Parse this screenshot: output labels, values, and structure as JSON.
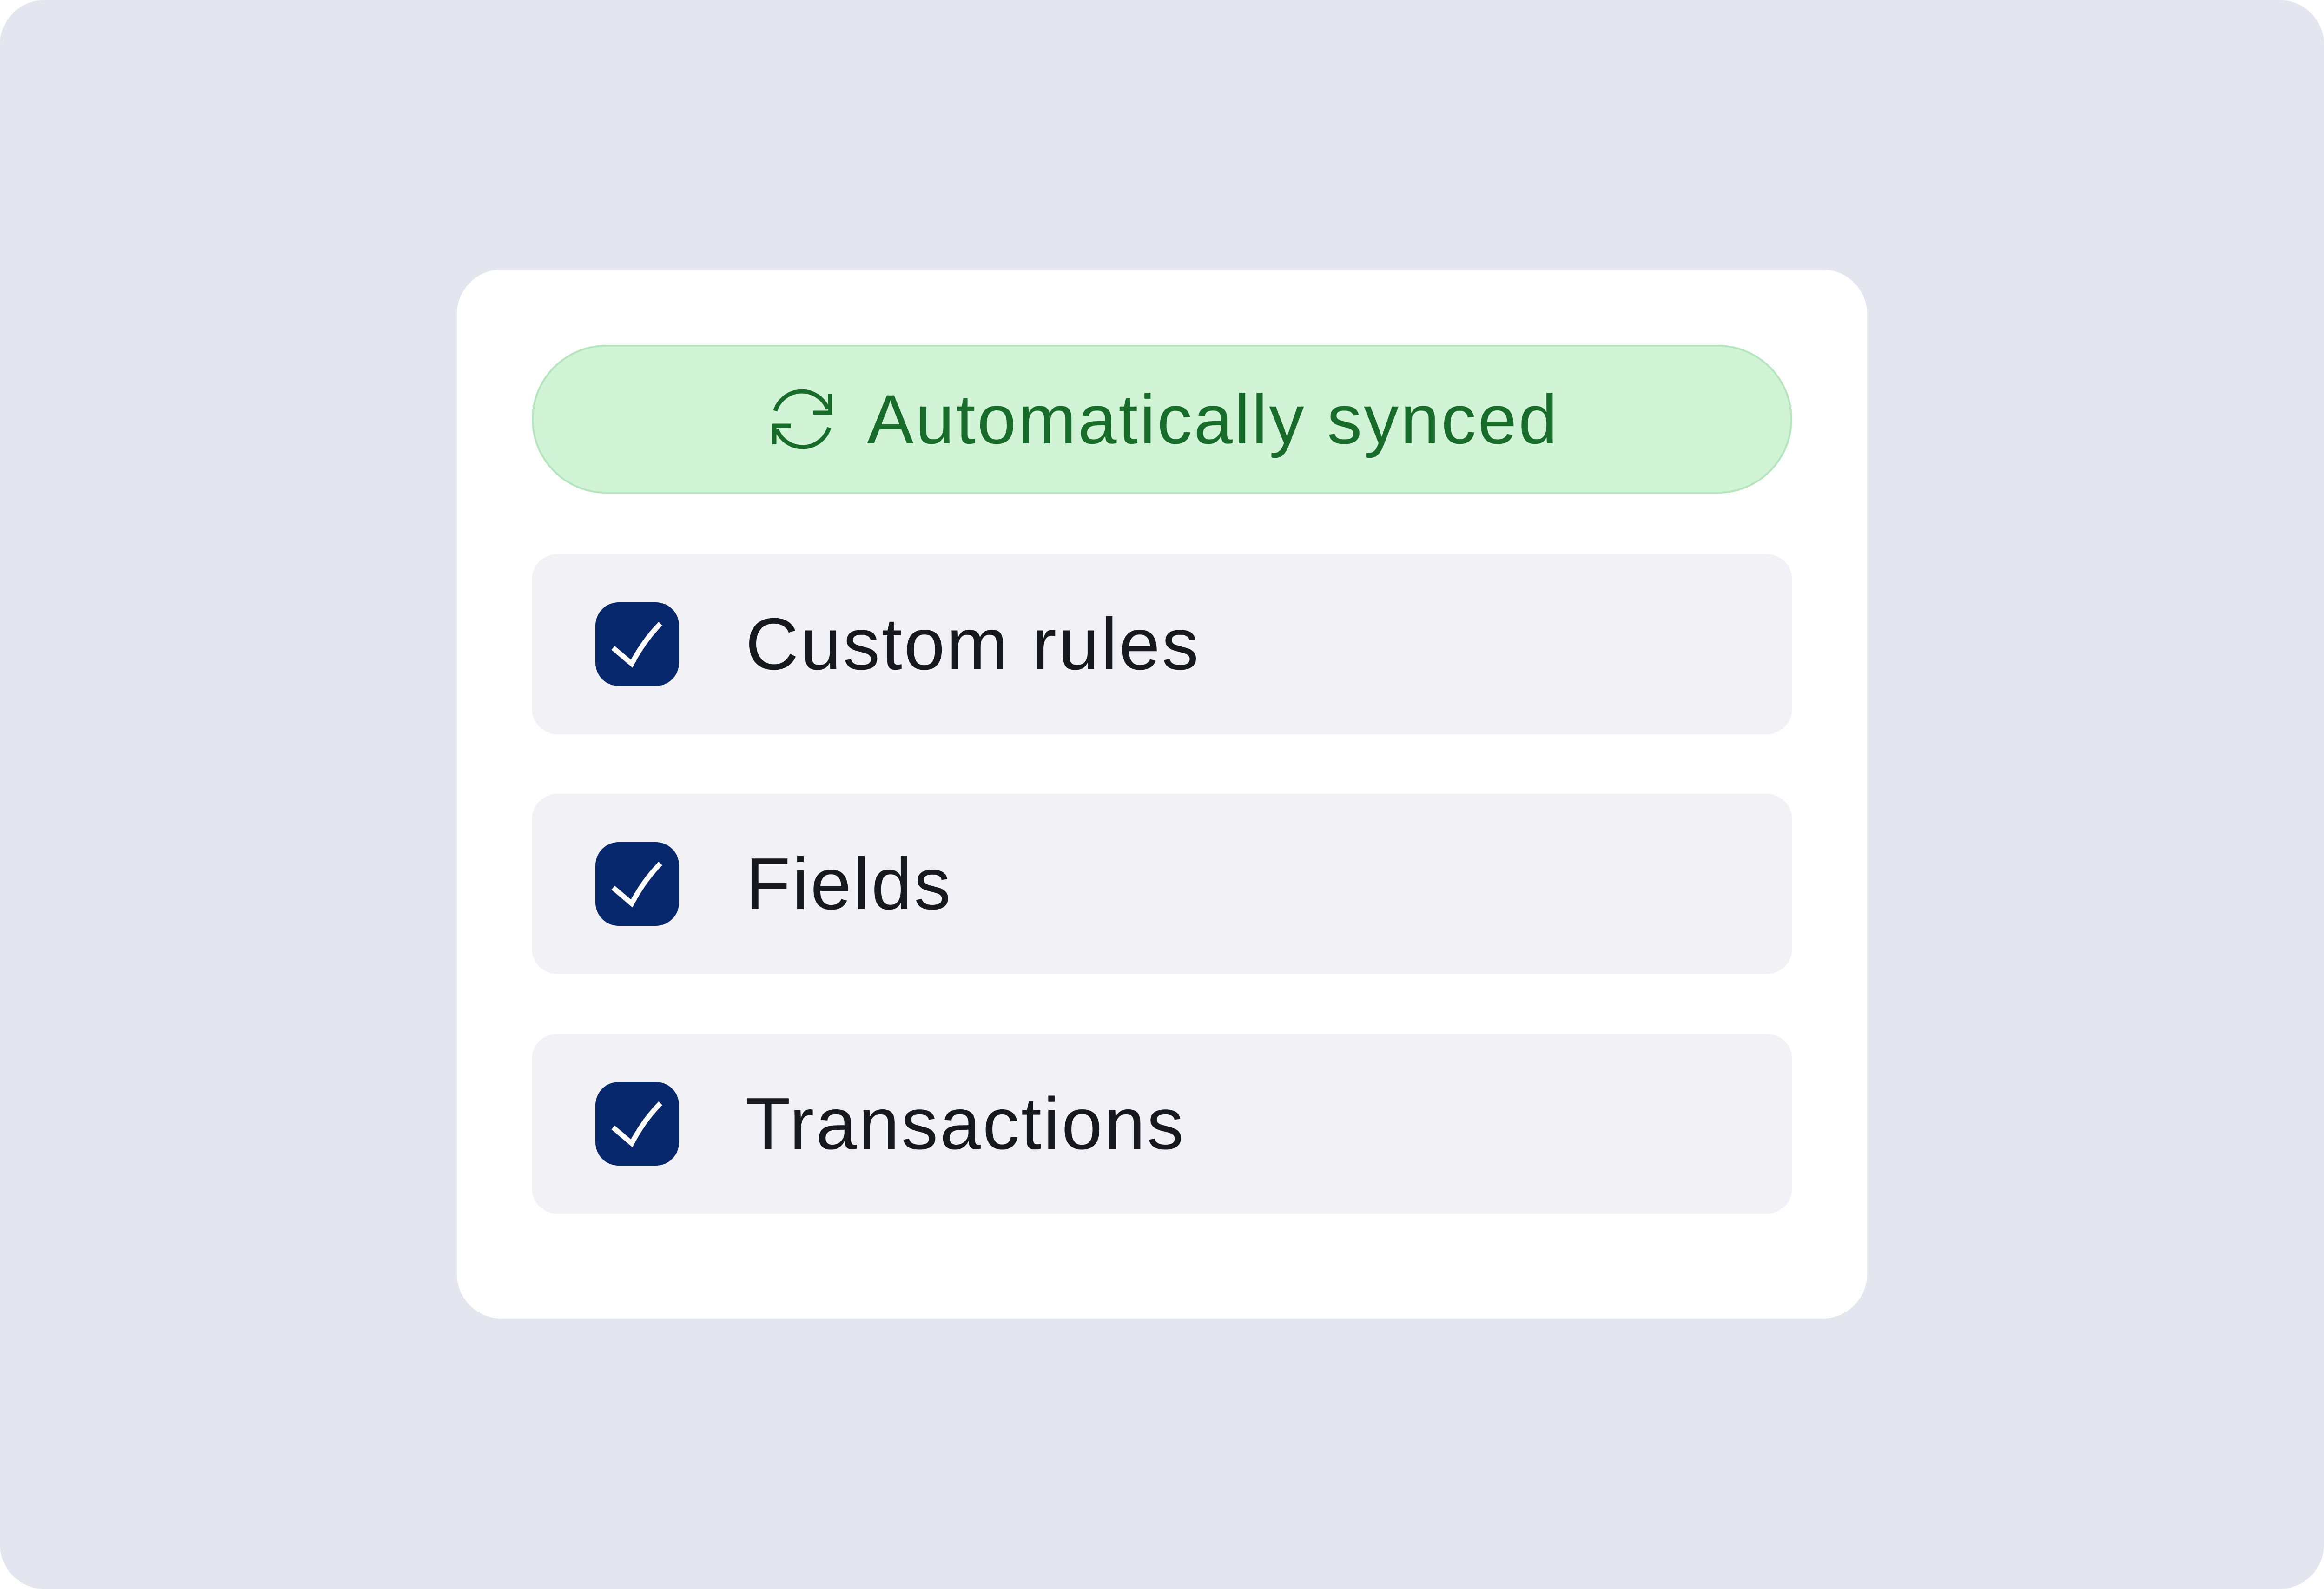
{
  "sync_status": {
    "label": "Automatically synced",
    "icon": "sync-icon",
    "text_color": "#176c29",
    "background_color": "#d1f4d6"
  },
  "options": [
    {
      "label": "Custom rules",
      "checked": true
    },
    {
      "label": "Fields",
      "checked": true
    },
    {
      "label": "Transactions",
      "checked": true
    }
  ],
  "colors": {
    "page_background": "#e3e6ef",
    "card_background": "#ffffff",
    "row_background": "#f1f1f6",
    "checkbox_fill": "#07286c",
    "label_text": "#16181d"
  }
}
